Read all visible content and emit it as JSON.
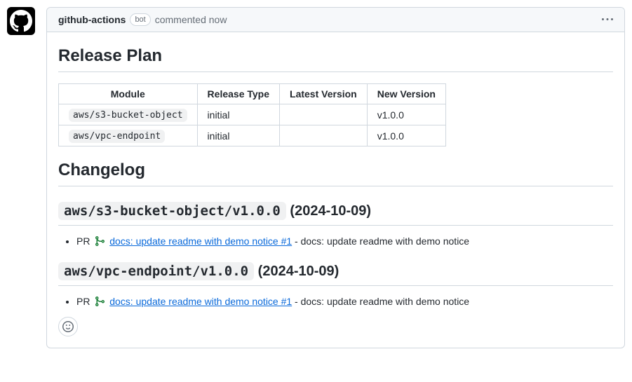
{
  "header": {
    "author": "github-actions",
    "bot_badge": "bot",
    "action_text": "commented now"
  },
  "sections": {
    "release_plan_title": "Release Plan",
    "changelog_title": "Changelog"
  },
  "table": {
    "headers": {
      "module": "Module",
      "release_type": "Release Type",
      "latest_version": "Latest Version",
      "new_version": "New Version"
    },
    "rows": [
      {
        "module": "aws/s3-bucket-object",
        "release_type": "initial",
        "latest_version": "",
        "new_version": "v1.0.0"
      },
      {
        "module": "aws/vpc-endpoint",
        "release_type": "initial",
        "latest_version": "",
        "new_version": "v1.0.0"
      }
    ]
  },
  "changelog": [
    {
      "code": "aws/s3-bucket-object/v1.0.0",
      "date": "(2024-10-09)",
      "pr_prefix": "PR",
      "pr_link_text": "docs: update readme with demo notice #1",
      "pr_suffix": " - docs: update readme with demo notice"
    },
    {
      "code": "aws/vpc-endpoint/v1.0.0",
      "date": "(2024-10-09)",
      "pr_prefix": "PR",
      "pr_link_text": "docs: update readme with demo notice #1",
      "pr_suffix": " - docs: update readme with demo notice"
    }
  ]
}
